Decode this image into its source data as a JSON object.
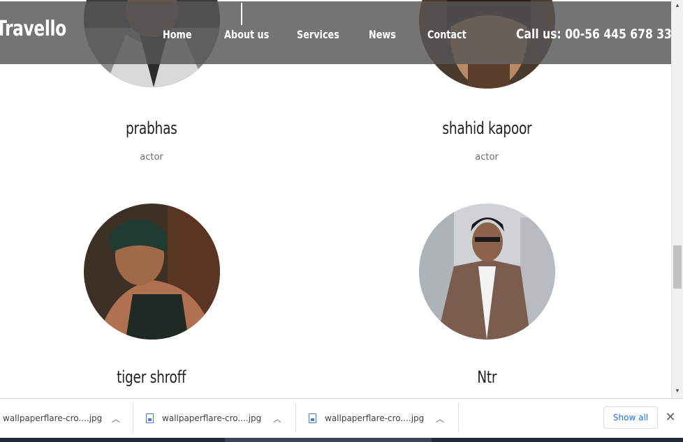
{
  "header": {
    "brand": "Travello",
    "nav": [
      {
        "label": "Home"
      },
      {
        "label": "About us"
      },
      {
        "label": "Services"
      },
      {
        "label": "News"
      },
      {
        "label": "Contact"
      }
    ],
    "call": "Call us: 00-56 445 678 33"
  },
  "team": [
    {
      "name": "prabhas",
      "role": "actor"
    },
    {
      "name": "shahid kapoor",
      "role": "actor"
    },
    {
      "name": "tiger shroff",
      "role": ""
    },
    {
      "name": "Ntr",
      "role": ""
    }
  ],
  "downloads": {
    "items": [
      {
        "filename": "wallpaperflare-cro....jpg"
      },
      {
        "filename": "wallpaperflare-cro....jpg"
      },
      {
        "filename": "wallpaperflare-cro....jpg"
      }
    ],
    "show_all": "Show all"
  },
  "colors": {
    "header_bg": "#555555",
    "link_blue": "#1a73e8",
    "role_text": "#6b6b7a"
  }
}
